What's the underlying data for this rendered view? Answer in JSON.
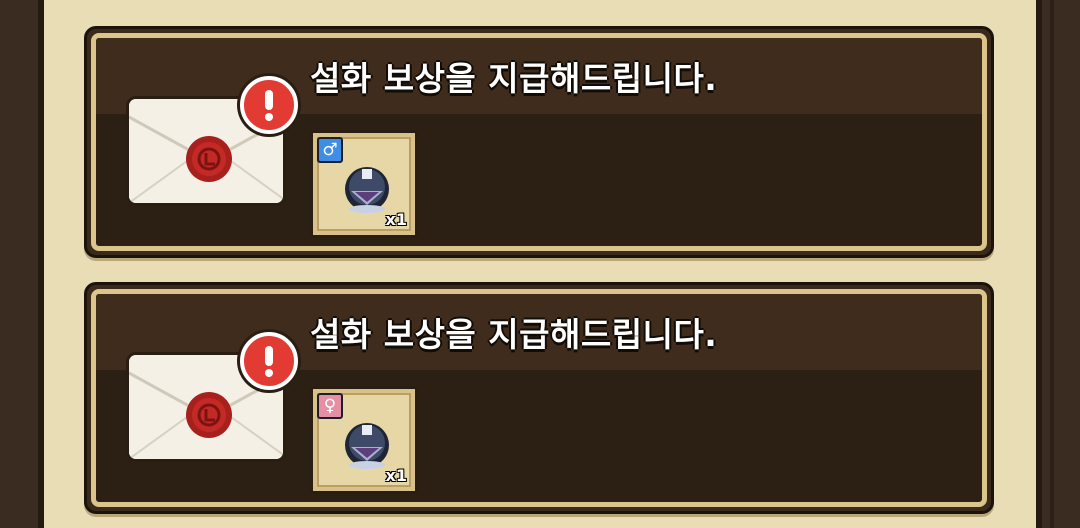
{
  "colors": {
    "background_parchment": "#e9ddb6",
    "card_dark": "#2c1f13",
    "card_border_gold": "#dcc58b",
    "alert_red": "#e23b34",
    "male_blue": "#3d8ee4",
    "female_pink": "#e68ea3"
  },
  "mails": [
    {
      "title": "설화 보상을 지급해드립니다.",
      "icon": "sealed-envelope-icon",
      "badge_icon": "exclamation-alert-icon",
      "reward": {
        "icon": "gem-helmet-icon",
        "gender": "male",
        "gender_symbol": "♂",
        "quantity": "x1"
      }
    },
    {
      "title": "설화 보상을 지급해드립니다.",
      "icon": "sealed-envelope-icon",
      "badge_icon": "exclamation-alert-icon",
      "reward": {
        "icon": "gem-helmet-icon",
        "gender": "female",
        "gender_symbol": "♀",
        "quantity": "x1"
      }
    }
  ]
}
